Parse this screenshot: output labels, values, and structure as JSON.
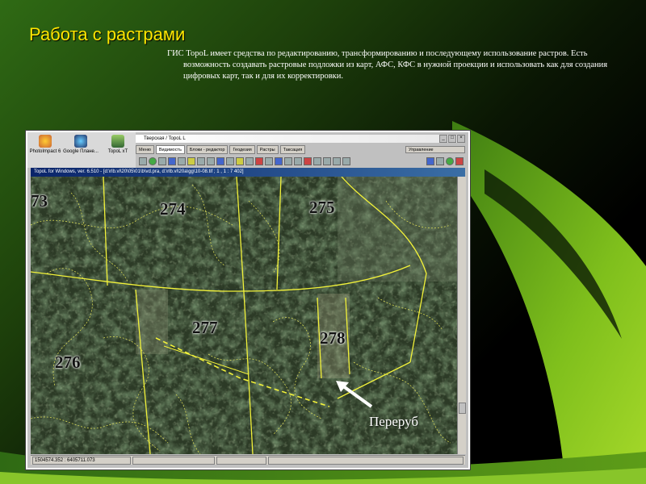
{
  "slide": {
    "title": "Работа с растрами",
    "paragraph": "ГИС TopoL имеет средства по редактированию, трансформированию и последующему использование растров. Есть возможность создавать растровые подложки из карт, АФС, КФС в нужной проекции и использовать как для создания цифровых карт, так и для их корректировки.",
    "callout": "Переруб",
    "colors": {
      "title": "#ffe600",
      "accent_green": "#8cc63f"
    }
  },
  "app": {
    "desktop_icons": [
      {
        "label": "PhotoImpact 6",
        "icon": "photoimpact-icon"
      },
      {
        "label": "Google Плане...",
        "icon": "google-earth-icon"
      },
      {
        "label": "TopoL xT",
        "icon": "topol-icon"
      }
    ],
    "window_title": "Тверская / TopoL L",
    "tabs": [
      "Меню",
      "Видимость",
      "Блоки - редактор",
      "Геодезия",
      "Растры",
      "Таксация"
    ],
    "active_tab": "Видимость",
    "side_panel": "Управление",
    "document_title": "TopoL for Windows, ver. 6.510 - [d:\\rlb.vl\\20\\05\\01\\b\\vd.pra, d:\\rlb.vl\\20a\\gg\\10-08.tif ; 1 , 1 : 7 402]",
    "status_coords": "1504574.352 : 6405711.073",
    "map_labels": [
      "73",
      "274",
      "275",
      "277",
      "278",
      "276"
    ]
  }
}
